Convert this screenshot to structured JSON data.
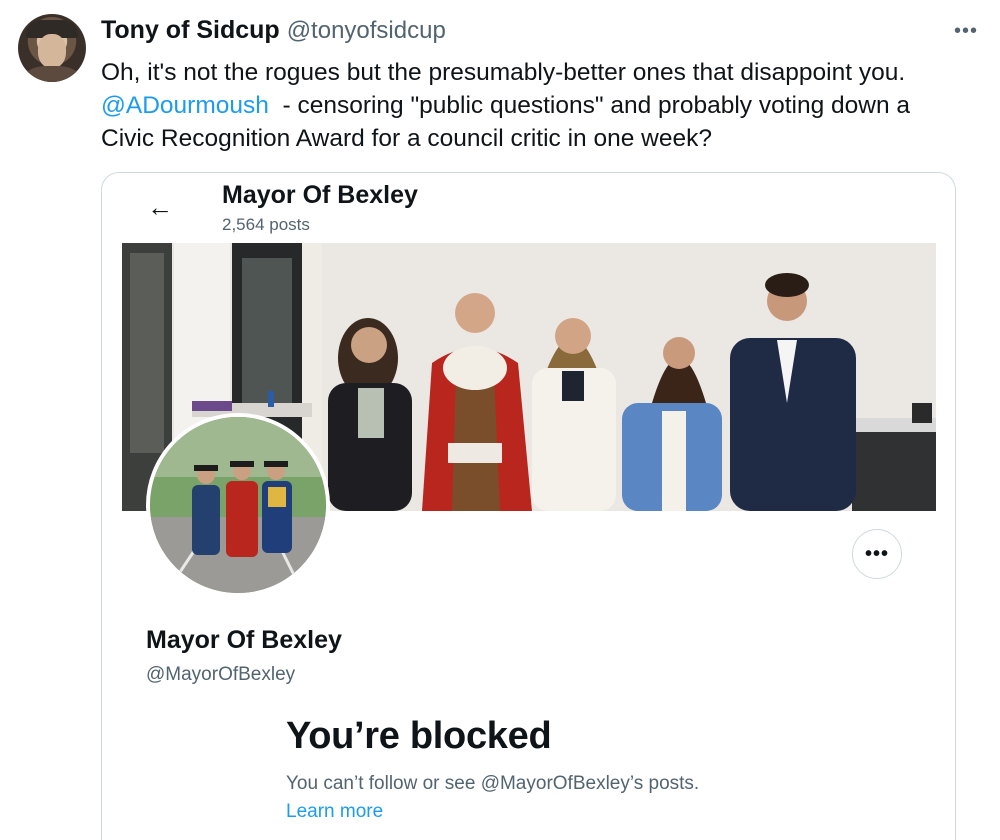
{
  "tweet": {
    "display_name": "Tony of Sidcup",
    "handle": "@tonyofsidcup",
    "more_icon": "•••",
    "text_line1": "Oh, it's not the rogues but the presumably-better ones that disappoint you.",
    "mention": "@ADourmoush",
    "text_line2_rest": "  - censoring \"public questions\" and probably voting down a",
    "text_line3": "Civic Recognition Award for a council critic in one week?"
  },
  "embed": {
    "back_icon": "←",
    "header_title": "Mayor Of Bexley",
    "header_posts": "2,564 posts",
    "more_icon": "•••",
    "profile_name": "Mayor Of Bexley",
    "profile_handle": "@MayorOfBexley",
    "blocked_title": "You’re blocked",
    "blocked_sub": "You can’t follow or see @MayorOfBexley’s posts.",
    "learn_more": "Learn more"
  },
  "colors": {
    "link": "#1d9bf0",
    "secondary_text": "#536471",
    "border": "#cfd9de"
  }
}
